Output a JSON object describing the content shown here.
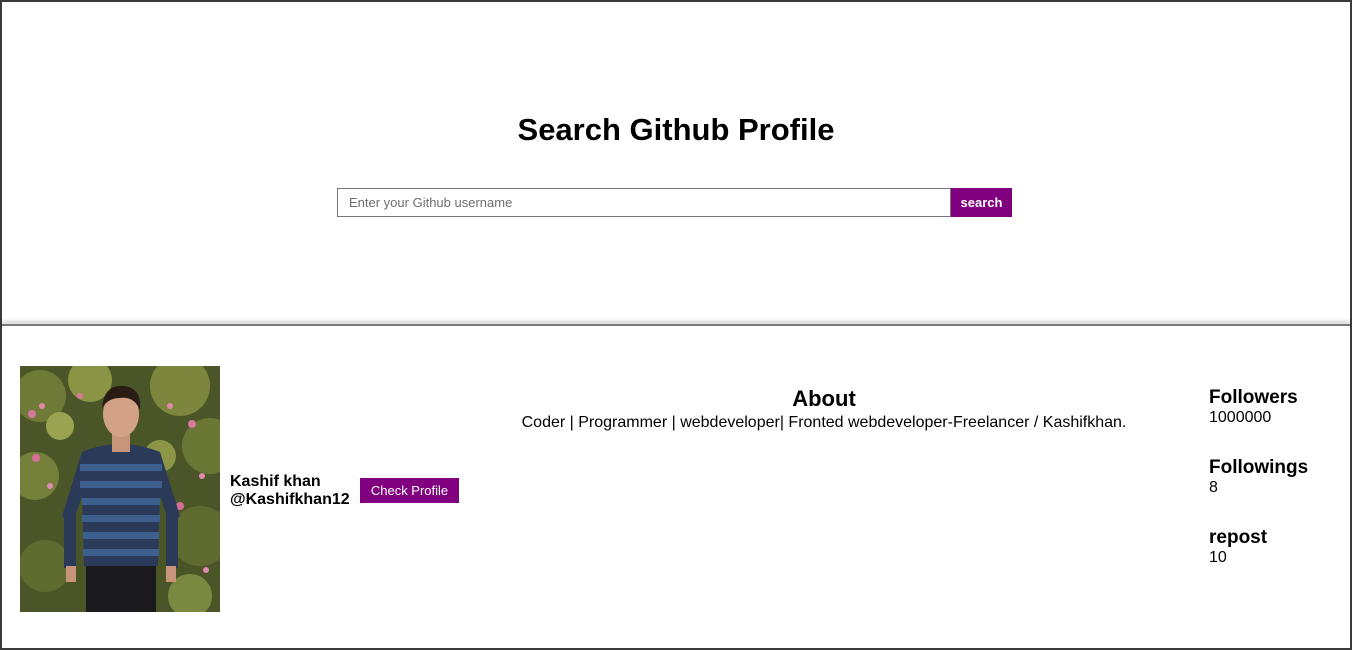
{
  "header": {
    "title": "Search Github Profile"
  },
  "search": {
    "placeholder": "Enter your Github username",
    "value": "",
    "button_label": "search"
  },
  "profile": {
    "name": "Kashif khan",
    "username": "@Kashifkhan12",
    "check_profile_label": "Check Profile",
    "about_heading": "About",
    "bio": "Coder | Programmer | webdeveloper| Fronted webdeveloper-Freelancer / Kashifkhan.",
    "stats": [
      {
        "label": "Followers",
        "value": "1000000"
      },
      {
        "label": "Followings",
        "value": "8"
      },
      {
        "label": "repost",
        "value": "10"
      }
    ]
  },
  "colors": {
    "accent": "#800080",
    "border": "#3a3a3a"
  },
  "icons": {
    "avatar": "profile-photo"
  }
}
